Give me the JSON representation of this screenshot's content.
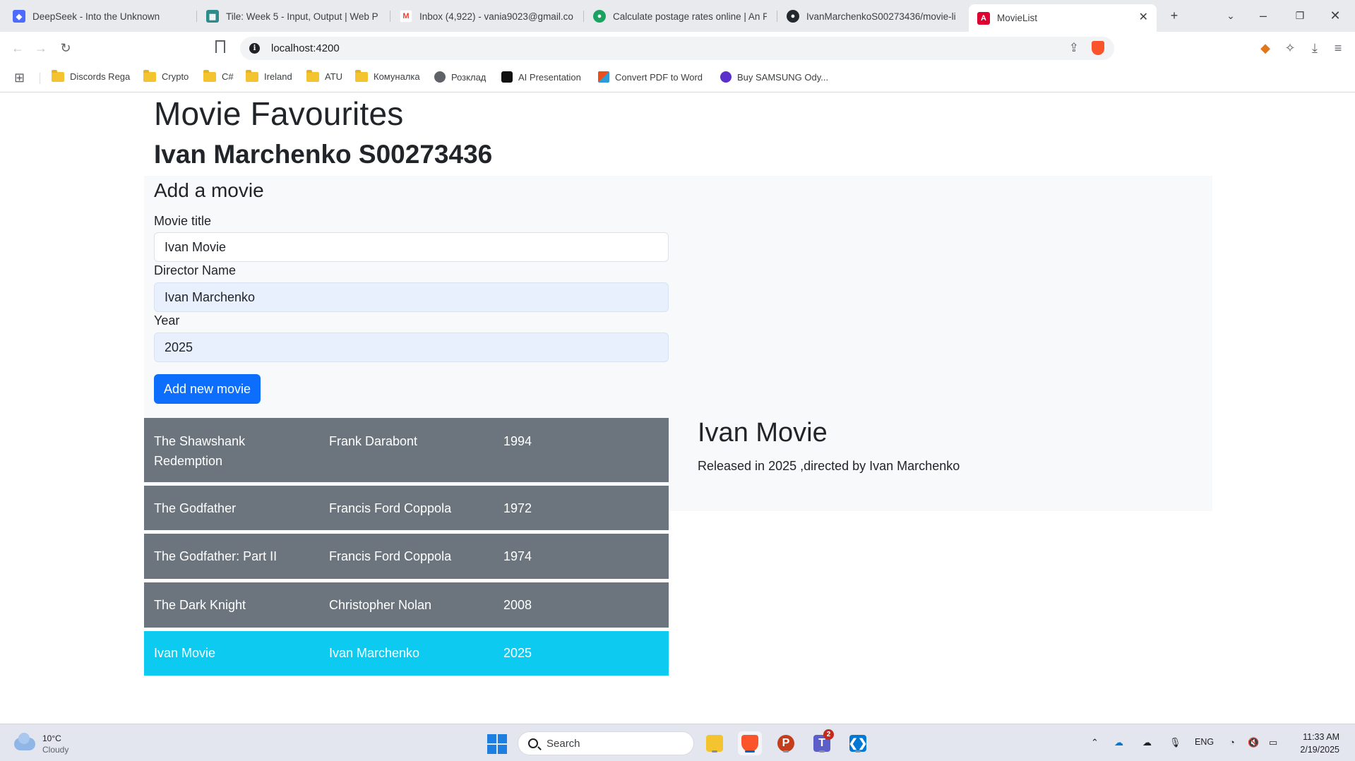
{
  "browser": {
    "tabs": [
      {
        "title": "DeepSeek - Into the Unknown",
        "icon": "deepseek-icon",
        "color": "#4d6bfe"
      },
      {
        "title": "Tile: Week 5 - Input, Output | Web P",
        "icon": "tile-icon",
        "color": "#2e8b8b"
      },
      {
        "title": "Inbox (4,922) - vania9023@gmail.co",
        "icon": "gmail-icon",
        "color": "#ea4335"
      },
      {
        "title": "Calculate postage rates online | An P",
        "icon": "anpost-icon",
        "color": "#1aa260"
      },
      {
        "title": "IvanMarchenkoS00273436/movie-li",
        "icon": "github-icon",
        "color": "#24292f"
      },
      {
        "title": "MovieList",
        "icon": "angular-icon",
        "color": "#dd0031",
        "active": true
      }
    ],
    "new_tab_symbol": "+",
    "address": {
      "url": "localhost:4200"
    },
    "bookmarks": [
      {
        "label": "Discords Rega",
        "type": "folder"
      },
      {
        "label": "Crypto",
        "type": "folder"
      },
      {
        "label": "C#",
        "type": "folder"
      },
      {
        "label": "Ireland",
        "type": "folder"
      },
      {
        "label": "ATU",
        "type": "folder"
      },
      {
        "label": "Комуналка",
        "type": "folder"
      },
      {
        "label": "Розклад",
        "type": "site",
        "color": "#5f6368"
      },
      {
        "label": "AI Presentation",
        "type": "site",
        "color": "#111111"
      },
      {
        "label": "Convert PDF to Word",
        "type": "site",
        "color": "#e94e1b"
      },
      {
        "label": "Buy SAMSUNG Ody...",
        "type": "site",
        "color": "#5b2fc9"
      }
    ]
  },
  "page": {
    "title": "Movie Favourites",
    "subtitle": "Ivan Marchenko S00273436",
    "form": {
      "heading": "Add a movie",
      "title_label": "Movie title",
      "title_value": "Ivan Movie",
      "director_label": "Director Name",
      "director_value": "Ivan Marchenko",
      "year_label": "Year",
      "year_value": "2025",
      "submit_label": "Add new movie"
    },
    "movies": [
      {
        "title": "The Shawshank Redemption",
        "director": "Frank Darabont",
        "year": "1994",
        "selected": false
      },
      {
        "title": "The Godfather",
        "director": "Francis Ford Coppola",
        "year": "1972",
        "selected": false
      },
      {
        "title": "The Godfather: Part II",
        "director": "Francis Ford Coppola",
        "year": "1974",
        "selected": false
      },
      {
        "title": "The Dark Knight",
        "director": "Christopher Nolan",
        "year": "2008",
        "selected": false
      },
      {
        "title": "Ivan Movie",
        "director": "Ivan Marchenko",
        "year": "2025",
        "selected": true
      }
    ],
    "detail": {
      "title": "Ivan Movie",
      "text": "Released in 2025 ,directed by Ivan Marchenko"
    },
    "colors": {
      "row_default": "#6c757d",
      "row_selected": "#0dcaf0",
      "primary_button": "#0d6efd",
      "form_panel": "#f8f9fa"
    }
  },
  "taskbar": {
    "weather_temp": "10°C",
    "weather_condition": "Cloudy",
    "search_placeholder": "Search",
    "teams_badge": "2",
    "language": "ENG",
    "time": "11:33 AM",
    "date": "2/19/2025"
  }
}
